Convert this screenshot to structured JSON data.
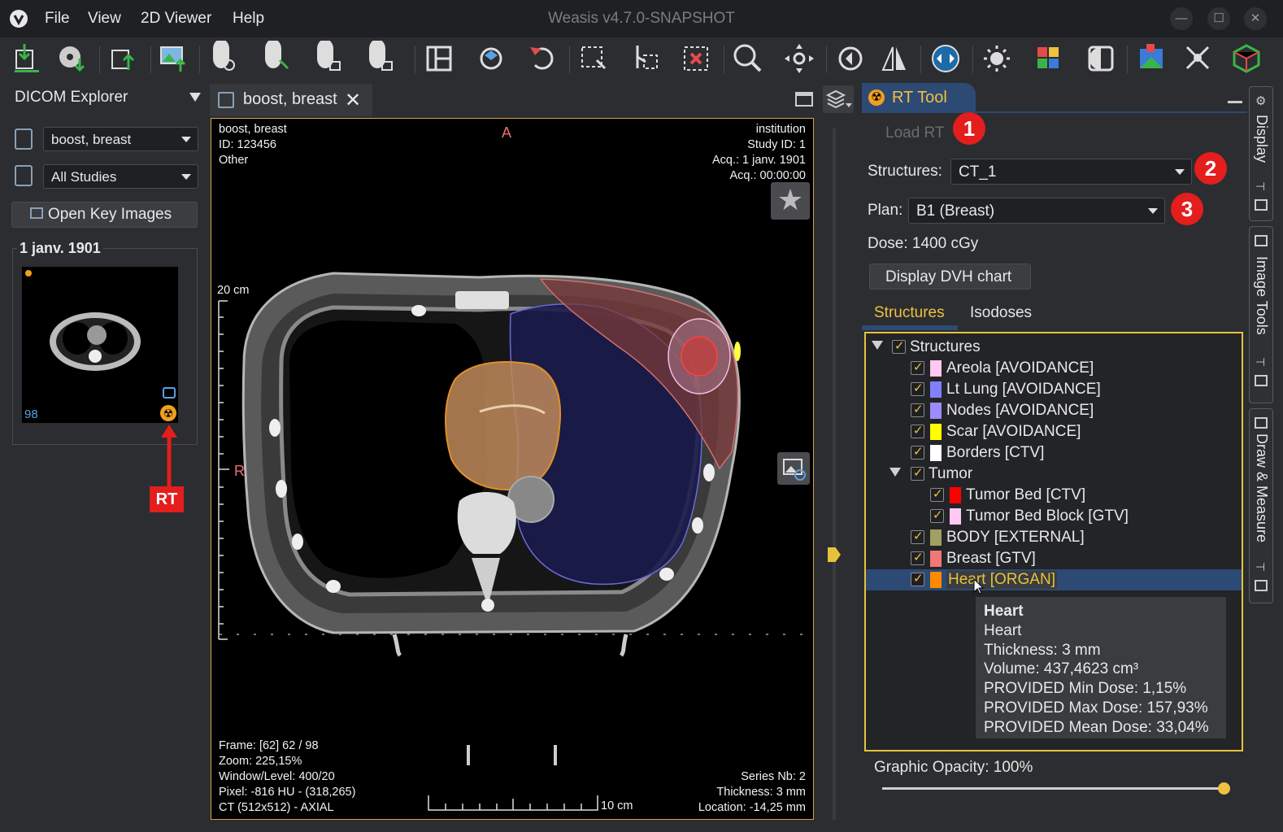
{
  "app": {
    "title": "Weasis v4.7.0-SNAPSHOT",
    "menu": [
      "File",
      "View",
      "2D Viewer",
      "Help"
    ],
    "window_controls": [
      "minimize-icon",
      "maximize-icon",
      "close-icon"
    ]
  },
  "explorer": {
    "title": "DICOM Explorer",
    "patient": "boost, breast",
    "studies": "All Studies",
    "open_key_images": "Open Key Images",
    "study_date": "1 janv. 1901",
    "thumb_count": "98",
    "rt_label": "RT"
  },
  "viewer": {
    "tab_title": "boost, breast",
    "top_left": [
      "boost, breast",
      "ID: 123456",
      "Other"
    ],
    "top_right": [
      "institution",
      "Study ID: 1",
      "Acq.: 1 janv. 1901",
      "Acq.: 00:00:00"
    ],
    "orient_top": "A",
    "orient_left": "R",
    "scale_label": "20 cm",
    "bottom_left": [
      "Frame: [62] 62 / 98",
      "Zoom: 225,15%",
      "Window/Level: 400/20",
      "Pixel: -816 HU - (318,265)",
      "CT (512x512) - AXIAL"
    ],
    "bottom_right": [
      "Series Nb: 2",
      "Thickness: 3 mm",
      "Location: -14,25 mm"
    ],
    "hscale_label": "10 cm"
  },
  "rt": {
    "title": "RT Tool",
    "load_rt": "Load RT",
    "structures_label": "Structures:",
    "structures_value": "CT_1",
    "plan_label": "Plan:",
    "plan_value": "B1 (Breast)",
    "dose": "Dose: 1400 cGy",
    "dvh_button": "Display DVH chart",
    "tabs": [
      "Structures",
      "Isodoses"
    ],
    "badges": [
      "1",
      "2",
      "3"
    ],
    "tree_root": "Structures",
    "items": [
      {
        "label": "Areola [AVOIDANCE]",
        "color": "#ffc8f0"
      },
      {
        "label": "Lt Lung [AVOIDANCE]",
        "color": "#8080ff"
      },
      {
        "label": "Nodes [AVOIDANCE]",
        "color": "#9a8cff"
      },
      {
        "label": "Scar [AVOIDANCE]",
        "color": "#ffff00"
      },
      {
        "label": "Borders [CTV]",
        "color": "#ffffff"
      }
    ],
    "tumor_group": "Tumor",
    "tumor_items": [
      {
        "label": "Tumor Bed [CTV]",
        "color": "#ff0000"
      },
      {
        "label": "Tumor Bed Block [GTV]",
        "color": "#ffc8f5"
      }
    ],
    "items_after": [
      {
        "label": "BODY [EXTERNAL]",
        "color": "#a0a060"
      },
      {
        "label": "Breast [GTV]",
        "color": "#f07878"
      },
      {
        "label": "Heart [ORGAN]",
        "color": "#ff8a00"
      }
    ],
    "tooltip": [
      "Heart",
      "Heart",
      "Thickness: 3 mm",
      "Volume: 437,4623 cm³",
      "PROVIDED Min Dose: 1,15%",
      "PROVIDED Max Dose: 157,93%",
      "PROVIDED Mean Dose: 33,04%"
    ],
    "opacity": "Graphic Opacity: 100%",
    "opacity_value": 1.0
  },
  "dock": {
    "tabs": [
      "Display",
      "Image Tools",
      "Draw & Measure"
    ]
  },
  "colors": {
    "accent": "#e6c23a",
    "badge": "#e41d1d",
    "selected_row": "#2d4a74"
  }
}
